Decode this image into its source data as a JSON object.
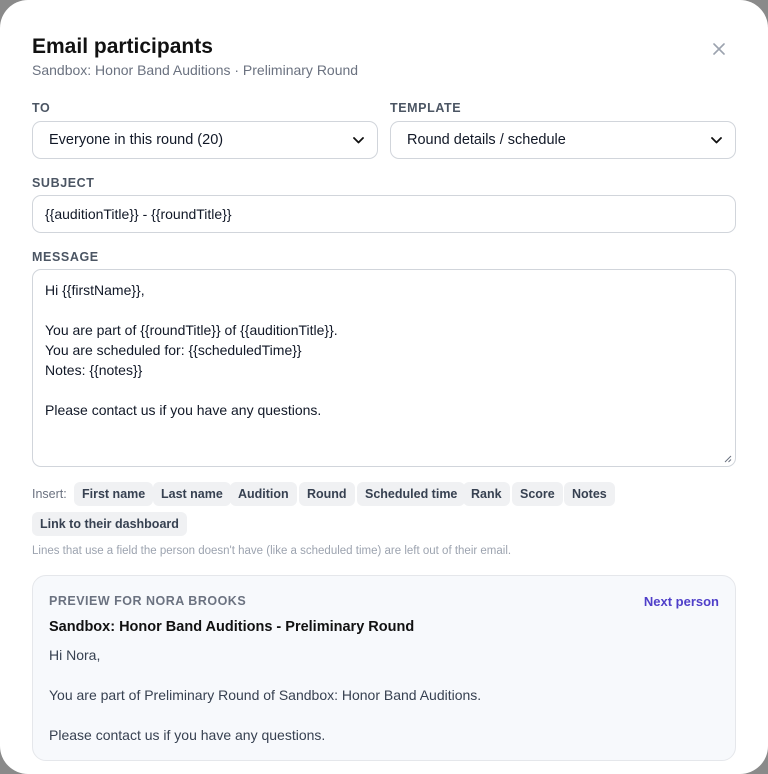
{
  "modal": {
    "title": "Email participants",
    "subtitle": "Sandbox: Honor Band Auditions · Preliminary Round",
    "close_icon": "close-icon"
  },
  "to": {
    "label": "TO",
    "selected": "Everyone in this round (20)"
  },
  "template": {
    "label": "TEMPLATE",
    "selected": "Round details / schedule"
  },
  "subject": {
    "label": "SUBJECT",
    "value": "{{auditionTitle}} - {{roundTitle}}"
  },
  "message": {
    "label": "MESSAGE",
    "lines": [
      "Hi {{firstName}},",
      "",
      "You are part of {{roundTitle}} of {{auditionTitle}}.",
      "You are scheduled for: {{scheduledTime}}",
      "Notes: {{notes}}",
      "",
      "Please contact us if you have any questions."
    ]
  },
  "insert": {
    "label": "Insert:",
    "chips": [
      "First name",
      "Last name",
      "Audition",
      "Round",
      "Scheduled time",
      "Rank",
      "Score",
      "Notes",
      "Link to their dashboard"
    ],
    "hint": "Lines that use a field the person doesn't have (like a scheduled time) are left out of their email."
  },
  "preview": {
    "label": "PREVIEW FOR NORA BROOKS",
    "next_label": "Next person",
    "subject": "Sandbox: Honor Band Auditions - Preliminary Round",
    "lines": [
      "Hi Nora,",
      "You are part of Preliminary Round of Sandbox: Honor Band Auditions.",
      "Please contact us if you have any questions."
    ]
  },
  "colors": {
    "accent": "#4f3fc9",
    "border": "#d1d5db",
    "chip_bg": "#f0f1f3",
    "preview_bg": "#f7f9fc"
  }
}
